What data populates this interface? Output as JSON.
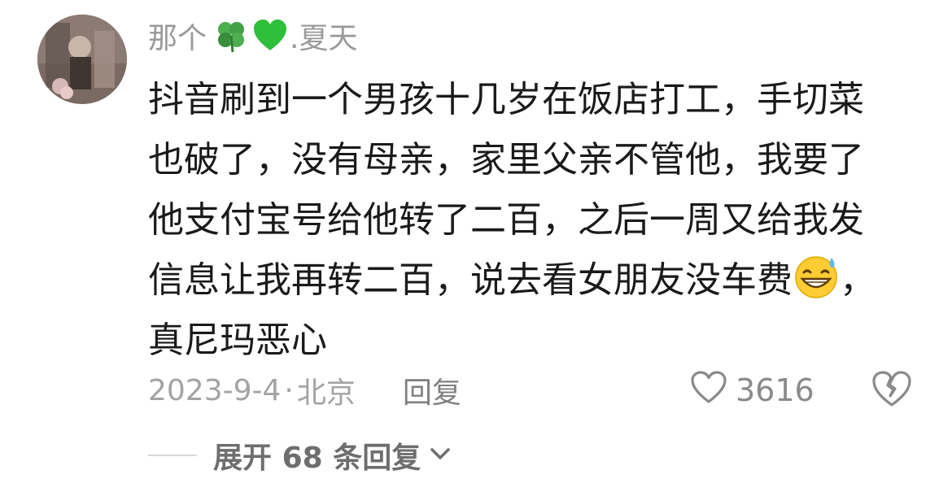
{
  "comment": {
    "username_prefix": "那个",
    "username_icons": [
      "four-leaf-clover-icon",
      "green-heart-icon"
    ],
    "username_suffix": ".夏天",
    "lines": [
      "抖音刷到一个男孩十几岁在饭店打工，手切菜",
      "也破了，没有母亲，家里父亲不管他，我要了",
      "他支付宝号给他转了二百，之后一周又给我发"
    ],
    "line4_text": "信息让我再转二百，说去看女朋友没车费",
    "line4_emoji": "grinning-sweat-emoji",
    "line4_tail": "，",
    "line5_text": "真尼玛恶心",
    "date": "2023-9-4",
    "separator": "·",
    "location": "北京",
    "reply_label": "回复",
    "like_count": "3616",
    "expand_prefix": "展开",
    "expand_count": "68",
    "expand_suffix": "条回复"
  },
  "colors": {
    "text": "#1a1a1a",
    "muted": "#9a9a9a",
    "background": "#ffffff"
  }
}
